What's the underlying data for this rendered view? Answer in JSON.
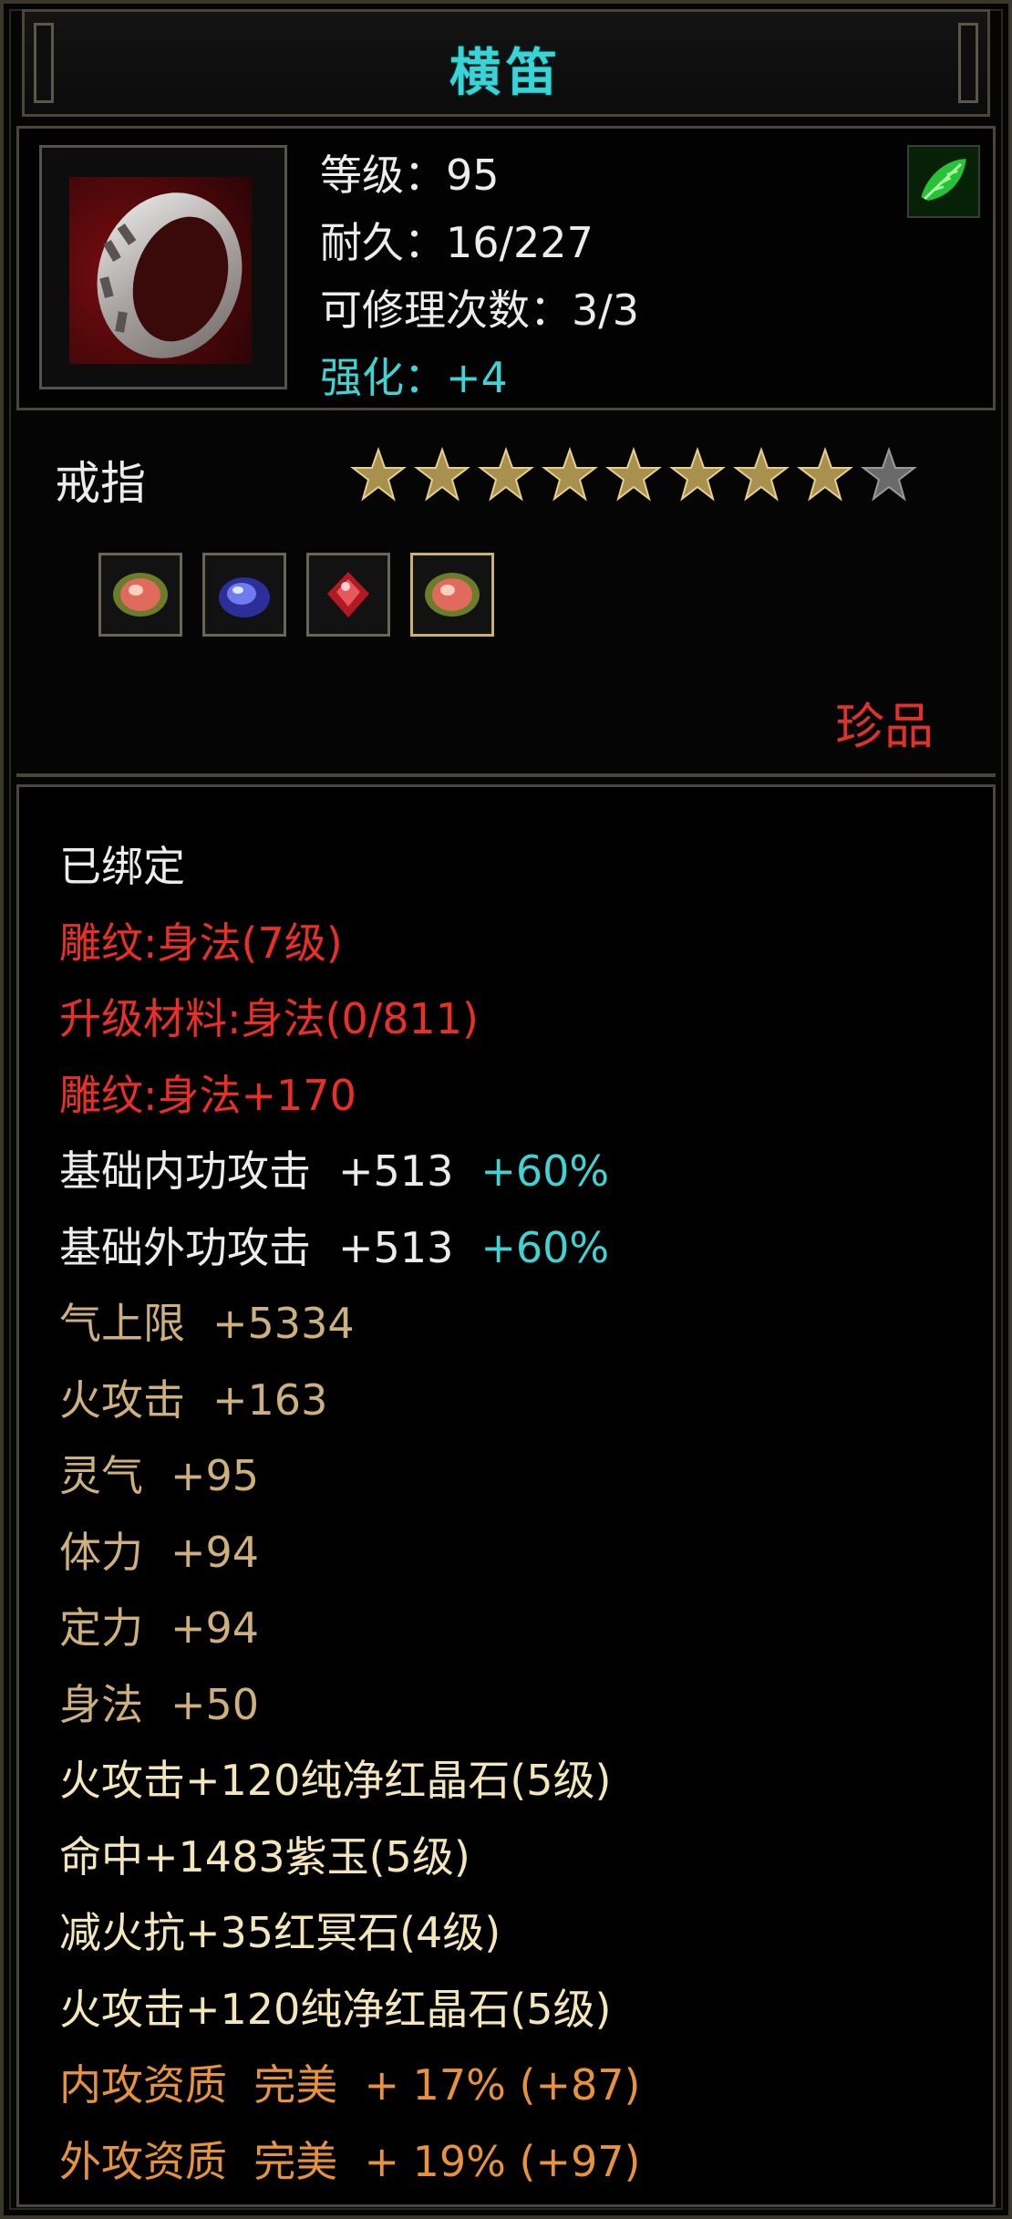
{
  "item": {
    "name": "横笛",
    "info": {
      "level": "等级：95",
      "durability": "耐久：16/227",
      "repair": "可修理次数：3/3",
      "enhance": "强化：+4"
    },
    "category": "戒指",
    "stars": {
      "filled": 8,
      "total": 9
    },
    "gems": [
      "red-gem",
      "blue-gem",
      "crimson-gem",
      "red-gem"
    ],
    "rarity": "珍品"
  },
  "colors": {
    "title": "#39d4d6",
    "cyan": "#3fd3d3",
    "red": "#ea2f29",
    "gold": "#cdb07c",
    "orange": "#e7933b"
  },
  "attributes": {
    "bound": "已绑定",
    "engrave_level": "雕纹:身法(7级)",
    "upgrade_material": "升级材料:身法(0/811)",
    "engrave_bonus": "雕纹:身法+170",
    "inner_attack": {
      "label": "基础内功攻击",
      "value": "+513",
      "pct": "+60%"
    },
    "outer_attack": {
      "label": "基础外功攻击",
      "value": "+513",
      "pct": "+60%"
    },
    "qi": {
      "label": "气上限",
      "value": "+5334"
    },
    "fire_attack": {
      "label": "火攻击",
      "value": "+163"
    },
    "spirit": {
      "label": "灵气",
      "value": "+95"
    },
    "stamina": {
      "label": "体力",
      "value": "+94"
    },
    "focus": {
      "label": "定力",
      "value": "+94"
    },
    "agility": {
      "label": "身法",
      "value": "+50"
    },
    "gem1": "火攻击+120纯净红晶石(5级)",
    "gem2": "命中+1483紫玉(5级)",
    "gem3": "减火抗+35红冥石(4级)",
    "gem4": "火攻击+120纯净红晶石(5级)",
    "inner_quality": "内攻资质  完美  + 17% (+87)",
    "outer_quality": "外攻资质  完美  + 19% (+97)"
  }
}
